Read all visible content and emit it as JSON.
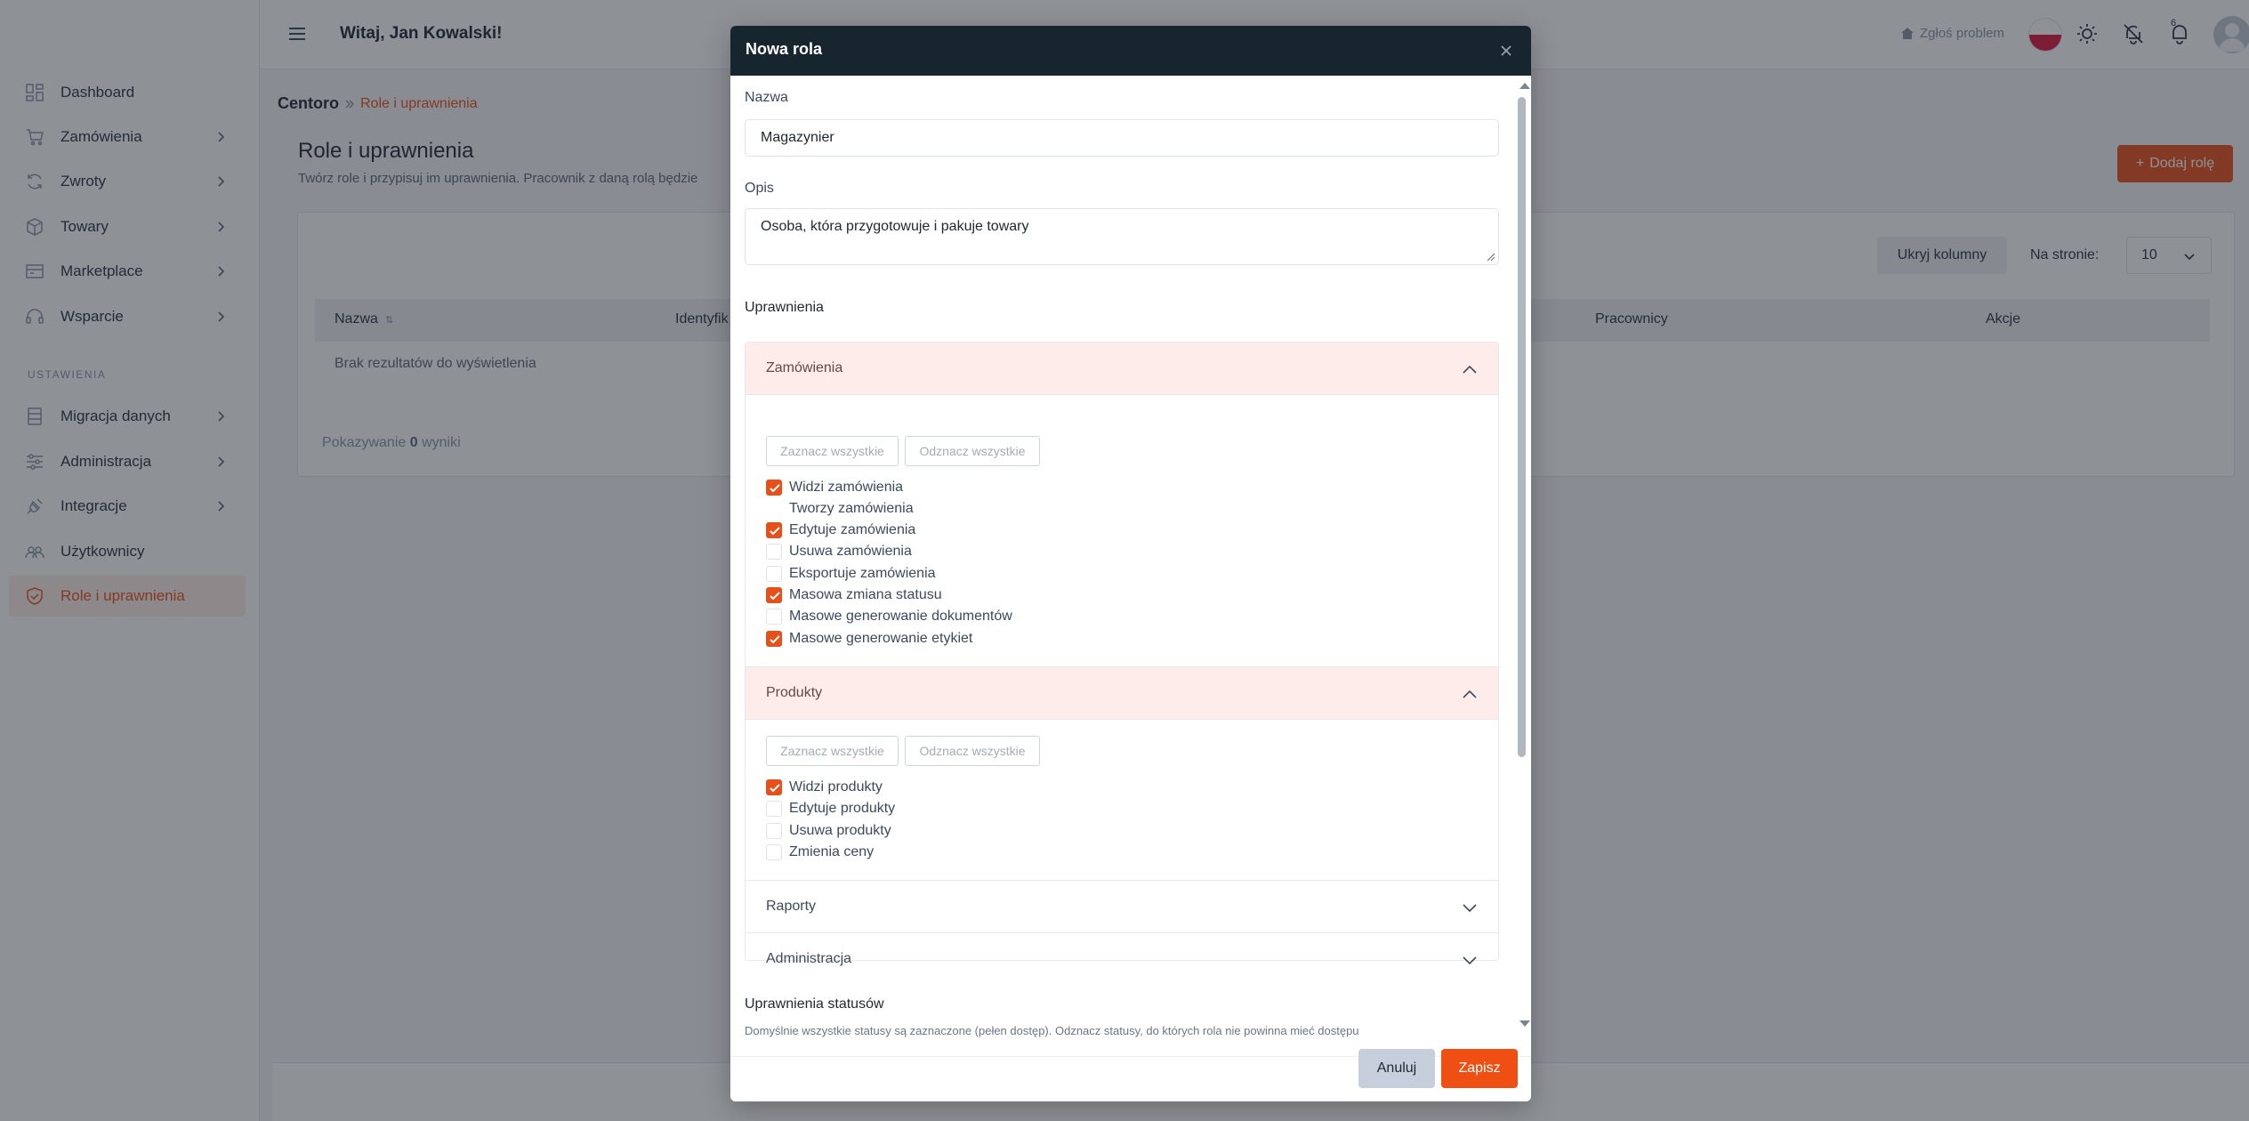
{
  "header": {
    "greeting": "Witaj, Jan Kowalski!",
    "report_label": "Zgłoś problem",
    "notification_count": "6"
  },
  "sidebar": {
    "items": [
      {
        "label": "Dashboard",
        "icon": "dashboard-icon",
        "has_chevron": false
      },
      {
        "label": "Zamówienia",
        "icon": "cart-icon",
        "has_chevron": true
      },
      {
        "label": "Zwroty",
        "icon": "refresh-icon",
        "has_chevron": true
      },
      {
        "label": "Towary",
        "icon": "box-icon",
        "has_chevron": true
      },
      {
        "label": "Marketplace",
        "icon": "store-icon",
        "has_chevron": true
      },
      {
        "label": "Wsparcie",
        "icon": "headset-icon",
        "has_chevron": true
      }
    ],
    "section_label": "USTAWIENIA",
    "settings_items": [
      {
        "label": "Migracja danych",
        "icon": "database-icon",
        "has_chevron": true
      },
      {
        "label": "Administracja",
        "icon": "sliders-icon",
        "has_chevron": true
      },
      {
        "label": "Integracje",
        "icon": "plug-icon",
        "has_chevron": true
      },
      {
        "label": "Użytkownicy",
        "icon": "users-icon",
        "has_chevron": false
      },
      {
        "label": "Role i uprawnienia",
        "icon": "shield-icon",
        "has_chevron": false,
        "active": true
      }
    ]
  },
  "main": {
    "breadcrumb": {
      "root": "Centoro",
      "current": "Role i uprawnienia"
    },
    "title": "Role i uprawnienia",
    "subtitle": "Twórz role i przypisuj im uprawnienia. Pracownik z daną rolą będzie",
    "add_button": "Dodaj rolę",
    "hide_columns": "Ukryj kolumny",
    "per_page_label": "Na stronie:",
    "per_page_value": "10",
    "columns": [
      "Nazwa",
      "Identyfik",
      "Pracownicy",
      "Akcje"
    ],
    "no_results": "Brak rezultatów do wyświetlenia",
    "showing_prefix": "Pokazywanie",
    "showing_count": "0",
    "showing_suffix": "wyniki"
  },
  "modal": {
    "title": "Nowa rola",
    "name_label": "Nazwa",
    "name_value": "Magazynier",
    "description_label": "Opis",
    "description_value": "Osoba, która przygotowuje i pakuje towary",
    "permissions_title": "Uprawnienia",
    "select_all": "Zaznacz wszystkie",
    "deselect_all": "Odznacz wszystkie",
    "groups": [
      {
        "title": "Zamówienia",
        "expanded": true,
        "permissions": [
          {
            "label": "Widzi zamówienia",
            "checked": true
          },
          {
            "label": "Tworzy zamówienia",
            "checked": false
          },
          {
            "label": "Edytuje zamówienia",
            "checked": true
          },
          {
            "label": "Usuwa zamówienia",
            "checked": false
          },
          {
            "label": "Eksportuje zamówienia",
            "checked": false
          },
          {
            "label": "Masowa zmiana statusu",
            "checked": true
          },
          {
            "label": "Masowe generowanie dokumentów",
            "checked": false
          },
          {
            "label": "Masowe generowanie etykiet",
            "checked": true
          }
        ]
      },
      {
        "title": "Produkty",
        "expanded": true,
        "permissions": [
          {
            "label": "Widzi produkty",
            "checked": true
          },
          {
            "label": "Edytuje produkty",
            "checked": false
          },
          {
            "label": "Usuwa produkty",
            "checked": false
          },
          {
            "label": "Zmienia ceny",
            "checked": false
          }
        ]
      },
      {
        "title": "Raporty",
        "expanded": false
      },
      {
        "title": "Administracja",
        "expanded": false
      }
    ],
    "status_title": "Uprawnienia statusów",
    "status_desc": "Domyślnie wszystkie statusy są zaznaczone (pełen dostęp). Odznacz statusy, do których rola nie powinna mieć dostępu",
    "cancel": "Anuluj",
    "save": "Zapisz"
  },
  "colors": {
    "accent": "#e8501b",
    "modal_header": "#17252f",
    "accordion_open": "#fdecea"
  }
}
